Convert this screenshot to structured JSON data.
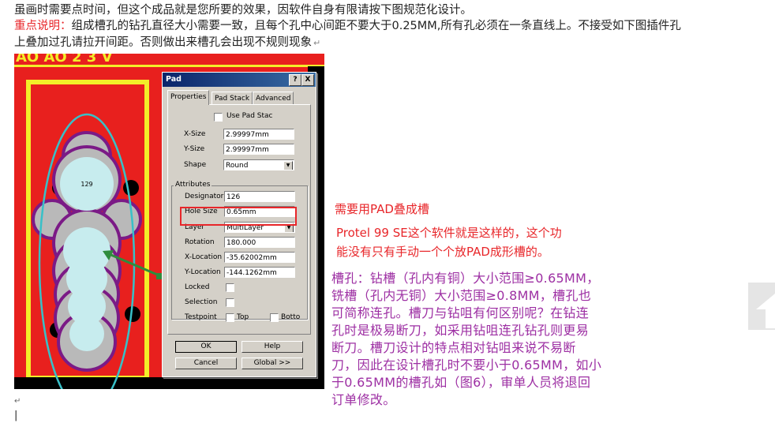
{
  "doc": {
    "line1": "虽画时需要点时间，但这个成品就是您所要的效果，因软件自身有限请按下图规范化设计。",
    "line2_lead": "重点说明：",
    "line2_rest": "组成槽孔的钻孔直径大小需要一致，且每个孔中心间距不要大于0.25MM,所有孔必须在一条直线上。不接受如下图插件孔",
    "line3": "上叠加过孔请拉开间距。否则做出来槽孔会出现不规则现象",
    "para_mark": "↵",
    "cursor_mark": "↵",
    "cursor_bar": "|"
  },
  "pcb": {
    "top_text": "AO AO 2 3 V",
    "pad_number": "129",
    "colors": {
      "board": "#e8201e",
      "outline": "#f3ee29",
      "pad_gray": "#b9b9b9",
      "ring_purple": "#7b1a86",
      "hole_fill": "#c7ecee",
      "ellipse": "#38c0c8",
      "arrow": "#2f8c3d"
    }
  },
  "dialog": {
    "title": "Pad",
    "help_btn": "?",
    "close_btn": "X",
    "tabs": [
      "Properties",
      "Pad Stack",
      "Advanced"
    ],
    "use_pad_stack": "Use Pad Stac",
    "x_size_label": "X-Size",
    "x_size": "2.99997mm",
    "y_size_label": "Y-Size",
    "y_size": "2.99997mm",
    "shape_label": "Shape",
    "shape": "Round",
    "attributes_title": "Attributes",
    "designator_label": "Designator",
    "designator": "126",
    "hole_size_label": "Hole Size",
    "hole_size": "0.65mm",
    "layer_label": "Layer",
    "layer": "MultiLayer",
    "rotation_label": "Rotation",
    "rotation": "180.000",
    "x_location_label": "X-Location",
    "x_location": "-35.62002mm",
    "y_location_label": "Y-Location",
    "y_location": "-144.1262mm",
    "locked_label": "Locked",
    "selection_label": "Selection",
    "testpoint_label": "Testpoint",
    "top_label": "Top",
    "bottom_label": "Botto",
    "ok": "OK",
    "help": "Help",
    "cancel": "Cancel",
    "global": "Global >>"
  },
  "notes": {
    "pad_slot": "需要用PAD叠成槽",
    "protel_line1": "Protel 99 SE这个软件就是这样的，这个功",
    "protel_line2": "能没有只有手动一个个放PAD成形槽的。",
    "para_lines": [
      "槽孔：钻槽（孔内有铜）大小范围≥0.65MM，",
      "铣槽（孔内无铜）大小范围≥0.8MM，槽孔也",
      "可简称连孔。槽刀与钻咀有何区别呢？在钻连",
      "孔时是极易断刀，如采用钻咀连孔钻孔则更易",
      "断刀。槽刀设计的特点相对钻咀来说不易断",
      "刀，因此在设计槽孔时不要小于0.65MM，如小",
      "于0.65MM的槽孔如（图6），审单人员将退回",
      "订单修改。"
    ]
  }
}
